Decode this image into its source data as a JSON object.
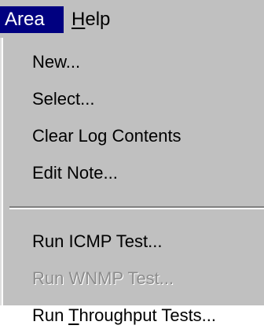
{
  "menubar": {
    "area_label": "Area",
    "help_prefix": "",
    "help_accel": "H",
    "help_rest": "elp"
  },
  "area_menu": {
    "items": [
      {
        "label": "New...",
        "enabled": true
      },
      {
        "label": "Select...",
        "enabled": true
      },
      {
        "label": "Clear Log Contents",
        "enabled": true
      },
      {
        "label": "Edit Note...",
        "enabled": true
      },
      {
        "label": "Run ICMP Test...",
        "enabled": true
      },
      {
        "label": "Run WNMP Test...",
        "enabled": false
      },
      {
        "prefix": "Run ",
        "accel": "T",
        "rest": "hroughput Tests...",
        "enabled": true
      }
    ]
  },
  "colors": {
    "menu_background": "#c0c0c0",
    "highlight": "#000080",
    "highlight_text": "#ffffff",
    "disabled_text": "#8c8c8c"
  }
}
